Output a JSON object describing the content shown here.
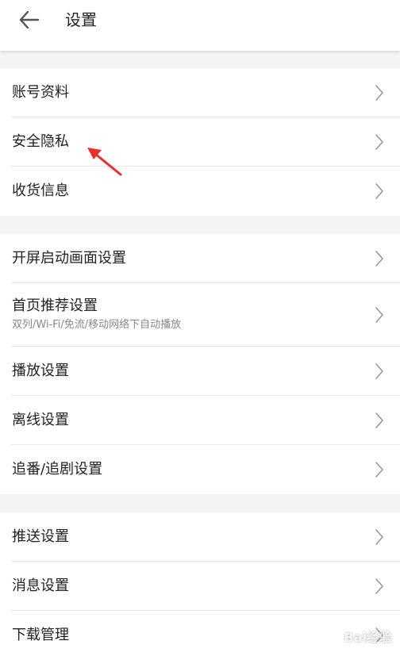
{
  "header": {
    "title": "设置",
    "back_icon": "arrow-left-icon"
  },
  "groups": [
    {
      "items": [
        {
          "label": "账号资料"
        },
        {
          "label": "安全隐私"
        },
        {
          "label": "收货信息"
        }
      ]
    },
    {
      "items": [
        {
          "label": "开屏启动画面设置"
        },
        {
          "label": "首页推荐设置",
          "sublabel": "双列/Wi-Fi/免流/移动网络下自动播放"
        },
        {
          "label": "播放设置"
        },
        {
          "label": "离线设置"
        },
        {
          "label": "追番/追剧设置"
        }
      ]
    },
    {
      "items": [
        {
          "label": "推送设置"
        },
        {
          "label": "消息设置"
        },
        {
          "label": "下载管理"
        }
      ]
    }
  ],
  "annotation": {
    "color": "#e8302e",
    "points_to": "安全隐私"
  },
  "watermark": "Bai经验",
  "colors": {
    "background": "#f4f4f4",
    "surface": "#ffffff",
    "divider": "#e6e6e6",
    "chevron": "#999999",
    "sublabel": "#888888"
  }
}
